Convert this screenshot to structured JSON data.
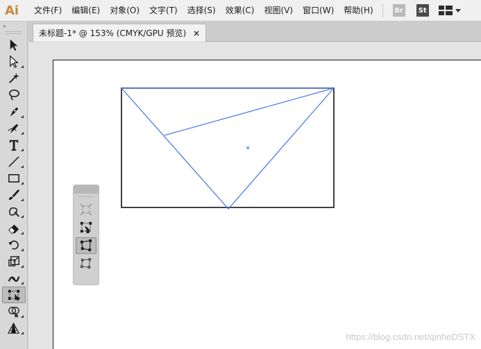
{
  "app": {
    "logo": "Ai",
    "menus": [
      "文件(F)",
      "编辑(E)",
      "对象(O)",
      "文字(T)",
      "选择(S)",
      "效果(C)",
      "视图(V)",
      "窗口(W)",
      "帮助(H)"
    ],
    "bridge_badge": "Br",
    "stock_badge": "St",
    "workspace_icon": "workspace-grid-icon"
  },
  "toolbar": {
    "collapse_label": "»",
    "tools": [
      {
        "name": "selection-tool-icon",
        "active": false,
        "corner": false
      },
      {
        "name": "direct-selection-tool-icon",
        "active": false,
        "corner": true
      },
      {
        "name": "magic-wand-tool-icon",
        "active": false,
        "corner": false
      },
      {
        "name": "lasso-tool-icon",
        "active": false,
        "corner": false
      },
      {
        "name": "pen-tool-icon",
        "active": false,
        "corner": true
      },
      {
        "name": "curvature-tool-icon",
        "active": false,
        "corner": true
      },
      {
        "name": "type-tool-icon",
        "active": false,
        "corner": true
      },
      {
        "name": "line-tool-icon",
        "active": false,
        "corner": true
      },
      {
        "name": "rectangle-tool-icon",
        "active": false,
        "corner": true
      },
      {
        "name": "paintbrush-tool-icon",
        "active": false,
        "corner": true
      },
      {
        "name": "shaper-tool-icon",
        "active": false,
        "corner": true
      },
      {
        "name": "eraser-tool-icon",
        "active": false,
        "corner": true
      },
      {
        "name": "rotate-tool-icon",
        "active": false,
        "corner": true
      },
      {
        "name": "scale-tool-icon",
        "active": false,
        "corner": true
      },
      {
        "name": "width-tool-icon",
        "active": false,
        "corner": true
      },
      {
        "name": "free-transform-tool-icon",
        "active": true,
        "corner": false
      },
      {
        "name": "shape-builder-tool-icon",
        "active": false,
        "corner": true
      },
      {
        "name": "perspective-grid-tool-icon",
        "active": false,
        "corner": true
      }
    ]
  },
  "document": {
    "tab_title": "未标题-1* @ 153% (CMYK/GPU 预览)",
    "close_label": "×"
  },
  "free_transform_panel": {
    "tools": [
      {
        "name": "constrain-icon",
        "active": false,
        "disabled": true
      },
      {
        "name": "free-transform-icon",
        "active": false,
        "disabled": false
      },
      {
        "name": "perspective-distort-icon",
        "active": true,
        "disabled": false
      },
      {
        "name": "free-distort-icon",
        "active": false,
        "disabled": false
      }
    ]
  },
  "watermark": "https://blog.csdn.net/qinheDSTX",
  "colors": {
    "accent": "#4a7de8",
    "logo": "#c58a37",
    "artboard_border": "#1a1a1a"
  }
}
